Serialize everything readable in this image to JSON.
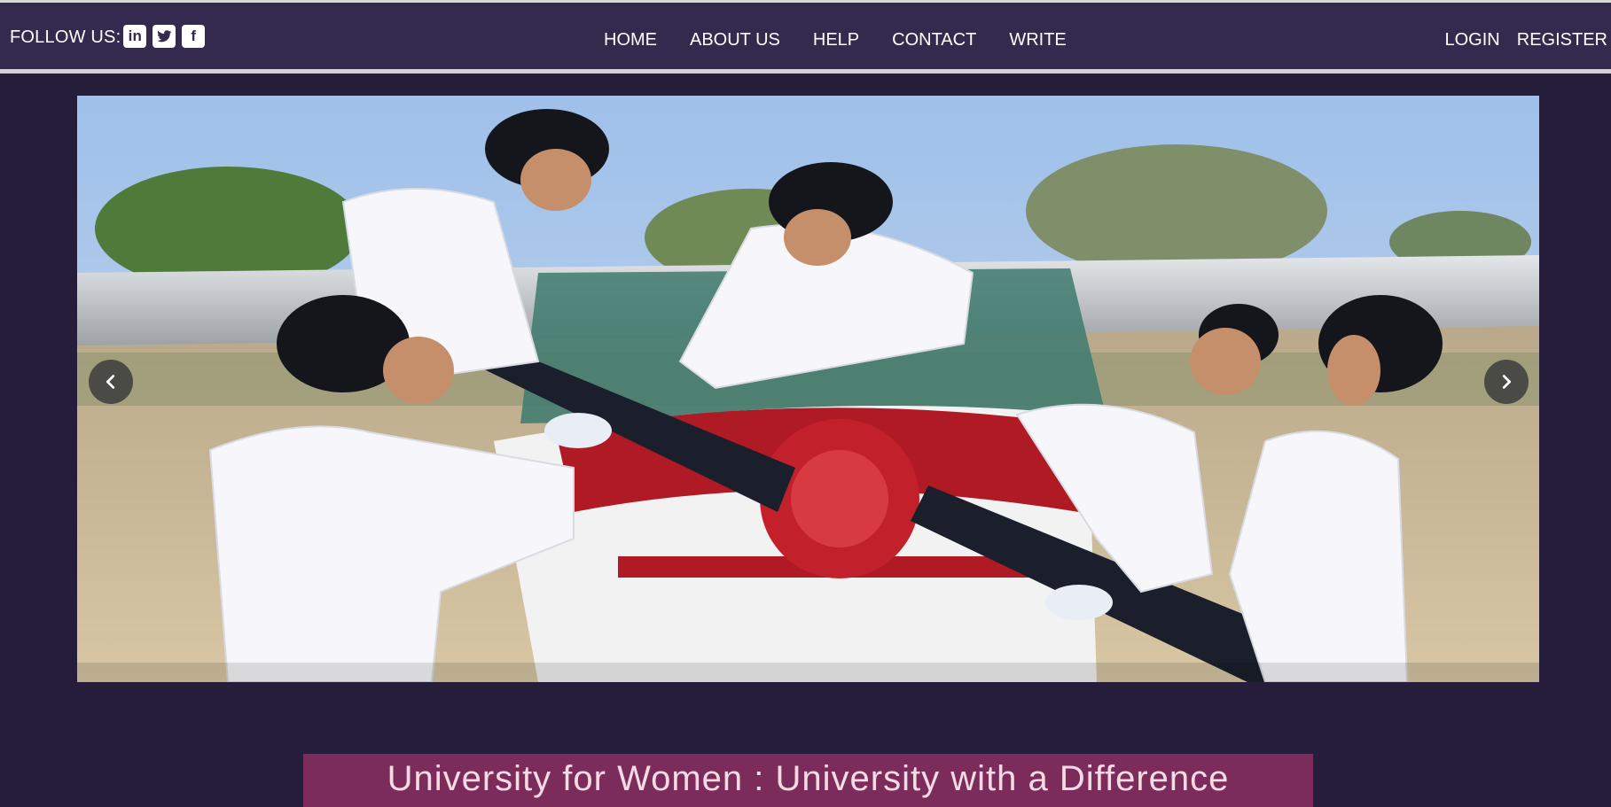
{
  "header": {
    "follow_label": "FOLLOW US:",
    "social": [
      {
        "icon": "linkedin-icon",
        "glyph": "in"
      },
      {
        "icon": "twitter-icon",
        "glyph": ""
      },
      {
        "icon": "facebook-icon",
        "glyph": "f"
      }
    ],
    "menu": [
      "HOME",
      "ABOUT US",
      "HELP",
      "CONTACT",
      "WRITE"
    ],
    "auth": {
      "login": "LOGIN",
      "register": "REGISTER"
    }
  },
  "carousel": {
    "image_alt": "Women pilots in white uniforms around a red and white propeller aircraft",
    "prev_icon": "chevron-left-icon",
    "next_icon": "chevron-right-icon"
  },
  "banner": {
    "title": "University for Women : University with a Difference"
  },
  "colors": {
    "page_bg": "#251d3a",
    "navbar_bg": "#342a4d",
    "banner_bg": "#7b2c5a",
    "banner_text": "#f5dbe6"
  }
}
